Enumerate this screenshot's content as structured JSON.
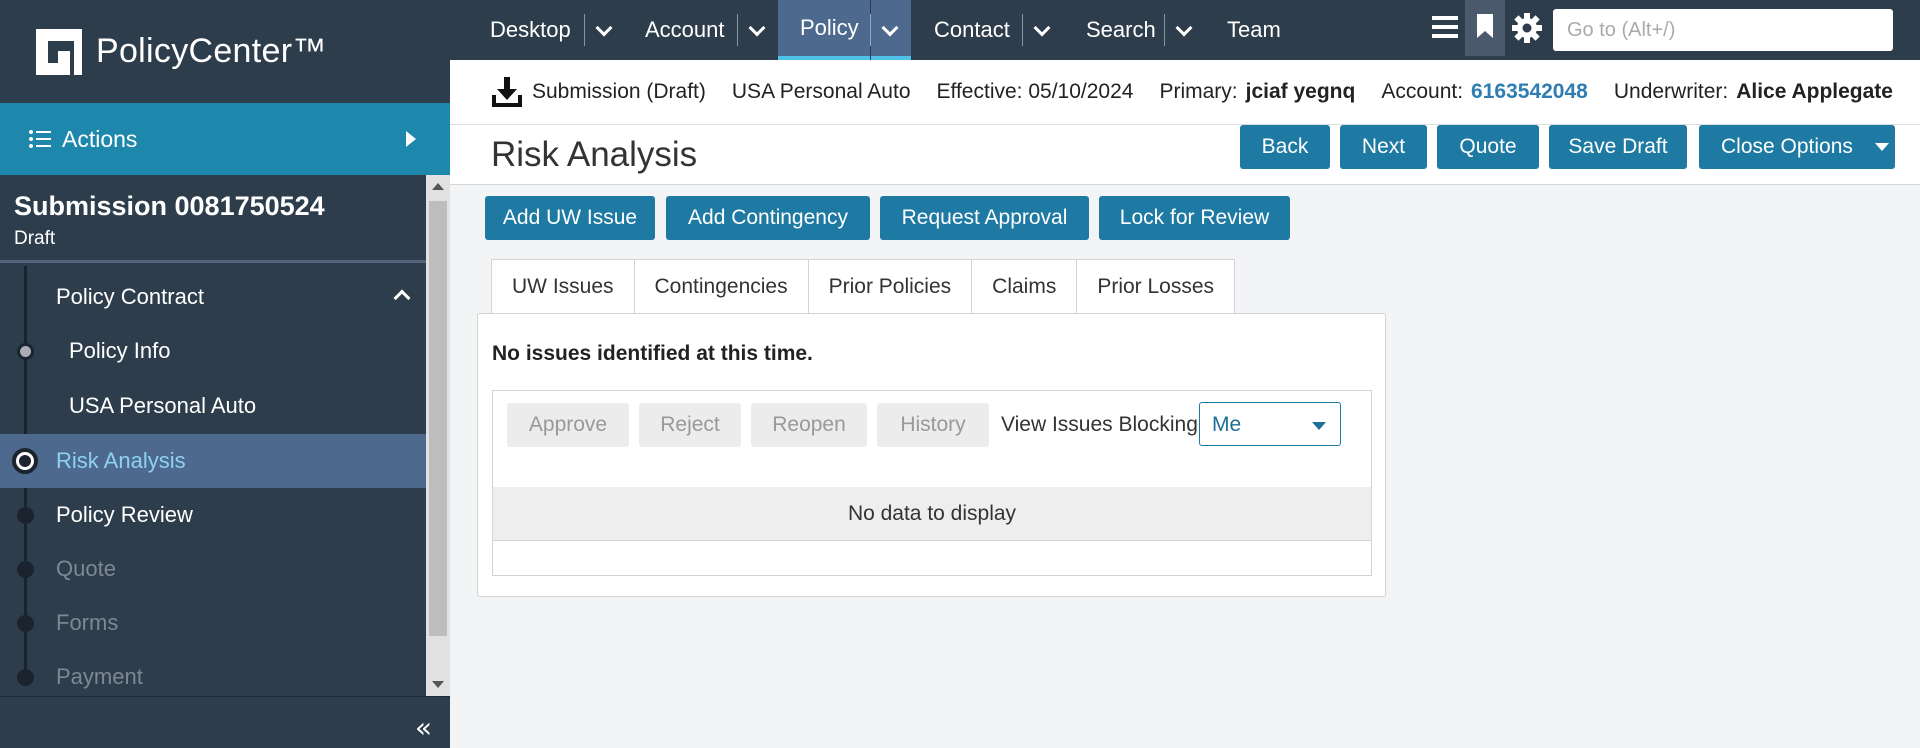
{
  "app": {
    "name": "PolicyCenter™"
  },
  "sidebar": {
    "actions_label": "Actions",
    "submission_title": "Submission 0081750524",
    "submission_status": "Draft",
    "nav": [
      {
        "label": "Policy Contract",
        "state": "group"
      },
      {
        "label": "Policy Info",
        "state": "done"
      },
      {
        "label": "USA Personal Auto",
        "state": "done"
      },
      {
        "label": "Risk Analysis",
        "state": "current"
      },
      {
        "label": "Policy Review",
        "state": "enabled"
      },
      {
        "label": "Quote",
        "state": "disabled"
      },
      {
        "label": "Forms",
        "state": "disabled"
      },
      {
        "label": "Payment",
        "state": "disabled"
      }
    ]
  },
  "topnav": {
    "items": [
      {
        "label": "Desktop"
      },
      {
        "label": "Account"
      },
      {
        "label": "Policy",
        "active": true
      },
      {
        "label": "Contact"
      },
      {
        "label": "Search"
      },
      {
        "label": "Team"
      }
    ],
    "goto_placeholder": "Go to (Alt+/)"
  },
  "infobar": {
    "submission": "Submission (Draft)",
    "product": "USA Personal Auto",
    "effective": "Effective: 05/10/2024",
    "primary_label": "Primary:",
    "primary_value": "jciaf yegnq",
    "account_label": "Account:",
    "account_value": "6163542048",
    "underwriter_label": "Underwriter:",
    "underwriter_value": "Alice Applegate"
  },
  "page": {
    "title": "Risk Analysis",
    "buttons": {
      "back": "Back",
      "next": "Next",
      "quote": "Quote",
      "save_draft": "Save Draft",
      "close_options": "Close Options"
    }
  },
  "actions": {
    "add_uw_issue": "Add UW Issue",
    "add_contingency": "Add Contingency",
    "request_approval": "Request Approval",
    "lock_for_review": "Lock for Review"
  },
  "tabs": [
    {
      "label": "UW Issues",
      "selected": true
    },
    {
      "label": "Contingencies"
    },
    {
      "label": "Prior Policies"
    },
    {
      "label": "Claims"
    },
    {
      "label": "Prior Losses"
    }
  ],
  "uw_issues": {
    "empty_message": "No issues identified at this time.",
    "approve": "Approve",
    "reject": "Reject",
    "reopen": "Reopen",
    "history": "History",
    "view_blocking_label": "View Issues Blocking",
    "view_blocking_value": "Me",
    "no_data": "No data to display"
  },
  "colors": {
    "sidebar_bg": "#2e3d4c",
    "accent": "#1e7aa3",
    "actions_bg": "#1e88ac",
    "active_nav": "#4d6a8e",
    "link": "#2f7db3"
  }
}
